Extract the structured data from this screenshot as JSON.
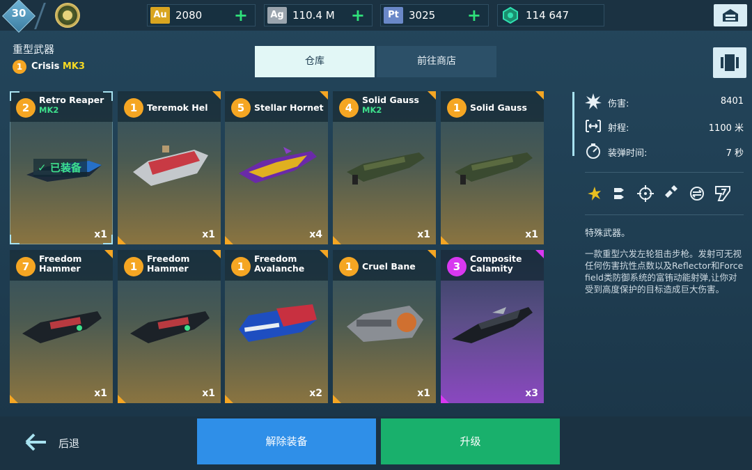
{
  "topbar": {
    "level": "30",
    "resources": [
      {
        "icon": "gold-icon",
        "symbol": "Au",
        "value": "2080",
        "color": "#d9a520"
      },
      {
        "icon": "silver-icon",
        "symbol": "Ag",
        "value": "110.4 M",
        "color": "#9aa4ad"
      },
      {
        "icon": "platinum-icon",
        "symbol": "Pt",
        "value": "3025",
        "color": "#6a88c8"
      },
      {
        "icon": "crystal-icon",
        "value": "114 647",
        "color": "#2fd0a0"
      }
    ]
  },
  "header": {
    "category_title": "重型武器",
    "equipped_count": "1",
    "equipped_name": "Crisis",
    "equipped_mk": "MK3"
  },
  "tabs": {
    "warehouse": "仓库",
    "shop": "前往商店"
  },
  "cards": [
    {
      "num": "2",
      "name": "Retro Reaper",
      "mk": "MK2",
      "count": "x1",
      "rarity": "orange",
      "equipped_label": "已装备"
    },
    {
      "num": "1",
      "name": "Teremok Hel",
      "mk": "",
      "count": "x1",
      "rarity": "orange"
    },
    {
      "num": "5",
      "name": "Stellar Hornet",
      "mk": "",
      "count": "x4",
      "rarity": "orange"
    },
    {
      "num": "4",
      "name": "Solid Gauss",
      "mk": "MK2",
      "count": "x1",
      "rarity": "orange"
    },
    {
      "num": "1",
      "name": "Solid Gauss",
      "mk": "",
      "count": "x1",
      "rarity": "orange"
    },
    {
      "num": "7",
      "name": "Freedom Hammer",
      "mk": "",
      "count": "x1",
      "rarity": "orange"
    },
    {
      "num": "1",
      "name": "Freedom Hammer",
      "mk": "",
      "count": "x1",
      "rarity": "orange"
    },
    {
      "num": "1",
      "name": "Freedom Avalanche",
      "mk": "",
      "count": "x2",
      "rarity": "orange"
    },
    {
      "num": "1",
      "name": "Cruel Bane",
      "mk": "",
      "count": "x1",
      "rarity": "orange"
    },
    {
      "num": "3",
      "name": "Composite Calamity",
      "mk": "",
      "count": "x3",
      "rarity": "purple"
    }
  ],
  "stats": [
    {
      "icon": "damage-icon",
      "label": "伤害:",
      "value": "8401"
    },
    {
      "icon": "range-icon",
      "label": "射程:",
      "value": "1100 米"
    },
    {
      "icon": "reload-icon",
      "label": "装弹时间:",
      "value": "7 秒"
    }
  ],
  "traits": [
    "burst-icon",
    "salvo-icon",
    "target-icon",
    "shield-pierce-icon",
    "reflect-icon",
    "shot-icon"
  ],
  "description": {
    "title": "特殊武器。",
    "text": "一款重型六发左轮狙击步枪。发射可无视任何伤害抗性点数以及Reflector和Forcefield类防御系统的富铕动能射弹,让你对受到高度保护的目标造成巨大伤害。"
  },
  "bottom": {
    "back": "后退",
    "unequip": "解除装备",
    "upgrade": "升级"
  }
}
